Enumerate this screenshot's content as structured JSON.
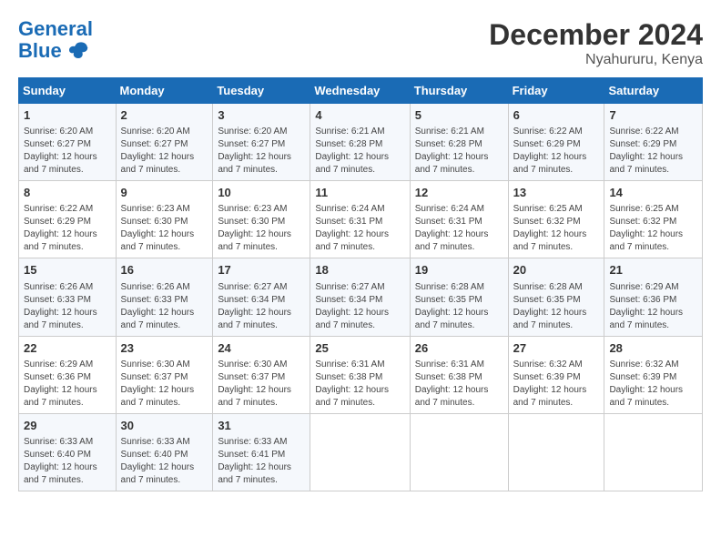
{
  "logo": {
    "line1": "General",
    "line2": "Blue"
  },
  "title": "December 2024",
  "location": "Nyahururu, Kenya",
  "days_header": [
    "Sunday",
    "Monday",
    "Tuesday",
    "Wednesday",
    "Thursday",
    "Friday",
    "Saturday"
  ],
  "weeks": [
    [
      {
        "day": "1",
        "sunrise": "6:20 AM",
        "sunset": "6:27 PM",
        "daylight": "12 hours and 7 minutes."
      },
      {
        "day": "2",
        "sunrise": "6:20 AM",
        "sunset": "6:27 PM",
        "daylight": "12 hours and 7 minutes."
      },
      {
        "day": "3",
        "sunrise": "6:20 AM",
        "sunset": "6:27 PM",
        "daylight": "12 hours and 7 minutes."
      },
      {
        "day": "4",
        "sunrise": "6:21 AM",
        "sunset": "6:28 PM",
        "daylight": "12 hours and 7 minutes."
      },
      {
        "day": "5",
        "sunrise": "6:21 AM",
        "sunset": "6:28 PM",
        "daylight": "12 hours and 7 minutes."
      },
      {
        "day": "6",
        "sunrise": "6:22 AM",
        "sunset": "6:29 PM",
        "daylight": "12 hours and 7 minutes."
      },
      {
        "day": "7",
        "sunrise": "6:22 AM",
        "sunset": "6:29 PM",
        "daylight": "12 hours and 7 minutes."
      }
    ],
    [
      {
        "day": "8",
        "sunrise": "6:22 AM",
        "sunset": "6:29 PM",
        "daylight": "12 hours and 7 minutes."
      },
      {
        "day": "9",
        "sunrise": "6:23 AM",
        "sunset": "6:30 PM",
        "daylight": "12 hours and 7 minutes."
      },
      {
        "day": "10",
        "sunrise": "6:23 AM",
        "sunset": "6:30 PM",
        "daylight": "12 hours and 7 minutes."
      },
      {
        "day": "11",
        "sunrise": "6:24 AM",
        "sunset": "6:31 PM",
        "daylight": "12 hours and 7 minutes."
      },
      {
        "day": "12",
        "sunrise": "6:24 AM",
        "sunset": "6:31 PM",
        "daylight": "12 hours and 7 minutes."
      },
      {
        "day": "13",
        "sunrise": "6:25 AM",
        "sunset": "6:32 PM",
        "daylight": "12 hours and 7 minutes."
      },
      {
        "day": "14",
        "sunrise": "6:25 AM",
        "sunset": "6:32 PM",
        "daylight": "12 hours and 7 minutes."
      }
    ],
    [
      {
        "day": "15",
        "sunrise": "6:26 AM",
        "sunset": "6:33 PM",
        "daylight": "12 hours and 7 minutes."
      },
      {
        "day": "16",
        "sunrise": "6:26 AM",
        "sunset": "6:33 PM",
        "daylight": "12 hours and 7 minutes."
      },
      {
        "day": "17",
        "sunrise": "6:27 AM",
        "sunset": "6:34 PM",
        "daylight": "12 hours and 7 minutes."
      },
      {
        "day": "18",
        "sunrise": "6:27 AM",
        "sunset": "6:34 PM",
        "daylight": "12 hours and 7 minutes."
      },
      {
        "day": "19",
        "sunrise": "6:28 AM",
        "sunset": "6:35 PM",
        "daylight": "12 hours and 7 minutes."
      },
      {
        "day": "20",
        "sunrise": "6:28 AM",
        "sunset": "6:35 PM",
        "daylight": "12 hours and 7 minutes."
      },
      {
        "day": "21",
        "sunrise": "6:29 AM",
        "sunset": "6:36 PM",
        "daylight": "12 hours and 7 minutes."
      }
    ],
    [
      {
        "day": "22",
        "sunrise": "6:29 AM",
        "sunset": "6:36 PM",
        "daylight": "12 hours and 7 minutes."
      },
      {
        "day": "23",
        "sunrise": "6:30 AM",
        "sunset": "6:37 PM",
        "daylight": "12 hours and 7 minutes."
      },
      {
        "day": "24",
        "sunrise": "6:30 AM",
        "sunset": "6:37 PM",
        "daylight": "12 hours and 7 minutes."
      },
      {
        "day": "25",
        "sunrise": "6:31 AM",
        "sunset": "6:38 PM",
        "daylight": "12 hours and 7 minutes."
      },
      {
        "day": "26",
        "sunrise": "6:31 AM",
        "sunset": "6:38 PM",
        "daylight": "12 hours and 7 minutes."
      },
      {
        "day": "27",
        "sunrise": "6:32 AM",
        "sunset": "6:39 PM",
        "daylight": "12 hours and 7 minutes."
      },
      {
        "day": "28",
        "sunrise": "6:32 AM",
        "sunset": "6:39 PM",
        "daylight": "12 hours and 7 minutes."
      }
    ],
    [
      {
        "day": "29",
        "sunrise": "6:33 AM",
        "sunset": "6:40 PM",
        "daylight": "12 hours and 7 minutes."
      },
      {
        "day": "30",
        "sunrise": "6:33 AM",
        "sunset": "6:40 PM",
        "daylight": "12 hours and 7 minutes."
      },
      {
        "day": "31",
        "sunrise": "6:33 AM",
        "sunset": "6:41 PM",
        "daylight": "12 hours and 7 minutes."
      },
      null,
      null,
      null,
      null
    ]
  ]
}
